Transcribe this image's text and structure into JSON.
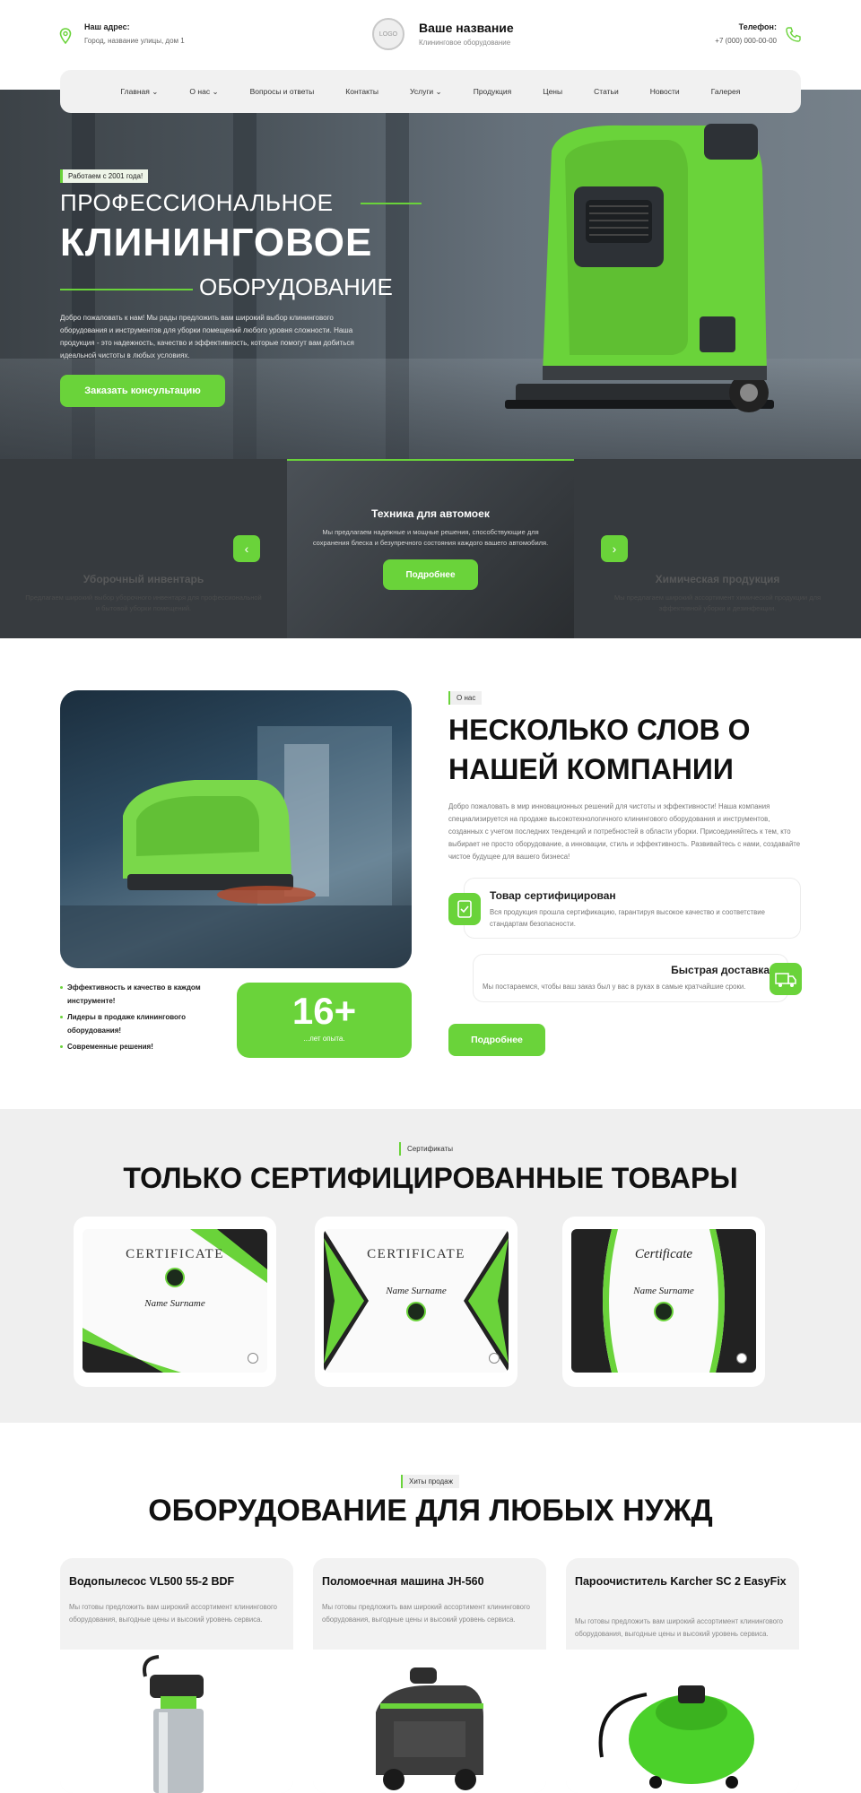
{
  "header": {
    "address_title": "Наш адрес:",
    "address_value": "Город, название улицы, дом 1",
    "logo_text": "LOGO",
    "brand_name": "Ваше название",
    "brand_subtitle": "Клининговое оборудование",
    "phone_title": "Телефон:",
    "phone_value": "+7 (000) 000-00-00"
  },
  "nav": {
    "items": [
      {
        "label": "Главная",
        "dropdown": true
      },
      {
        "label": "О нас",
        "dropdown": true
      },
      {
        "label": "Вопросы и ответы",
        "dropdown": false
      },
      {
        "label": "Контакты",
        "dropdown": false
      },
      {
        "label": "Услуги",
        "dropdown": true
      },
      {
        "label": "Продукция",
        "dropdown": false
      },
      {
        "label": "Цены",
        "dropdown": false
      },
      {
        "label": "Статьи",
        "dropdown": false
      },
      {
        "label": "Новости",
        "dropdown": false
      },
      {
        "label": "Галерея",
        "dropdown": false
      }
    ]
  },
  "hero": {
    "badge": "Работаем с 2001 года!",
    "title_line1": "ПРОФЕССИОНАЛЬНОЕ",
    "title_line2": "КЛИНИНГОВОЕ",
    "title_line3": "ОБОРУДОВАНИЕ",
    "description": "Добро пожаловать к нам! Мы рады предложить вам широкий выбор клинингового оборудования и инструментов для уборки помещений любого уровня сложности. Наша продукция - это надежность, качество и эффективность, которые помогут вам добиться идеальной чистоты в любых условиях.",
    "cta": "Заказать консультацию"
  },
  "slider": {
    "slides": [
      {
        "title": "Уборочный инвентарь",
        "text": "Предлагаем широкий выбор уборочного инвентаря для профессиональной и бытовой уборки помещений."
      },
      {
        "title": "Техника для автомоек",
        "text": "Мы предлагаем надежные и мощные решения, способствующие для сохранения блеска и безупречного состояния каждого вашего автомобиля.",
        "button": "Подробнее"
      },
      {
        "title": "Химическая продукция",
        "text": "Мы предлагаем широкий ассортимент химической продукции для эффективной уборки и дезинфекции."
      }
    ],
    "prev_icon": "chevron-left-icon",
    "next_icon": "chevron-right-icon"
  },
  "about": {
    "tag": "О нас",
    "title": "НЕСКОЛЬКО СЛОВ О НАШЕЙ КОМПАНИИ",
    "text": "Добро пожаловать в мир инновационных решений для чистоты и эффективности! Наша компания специализируется на продаже высокотехнологичного клинингового оборудования и инструментов, созданных с учетом последних тенденций и потребностей в области уборки. Присоединяйтесь к тем, кто выбирает не просто оборудование, а инновации, стиль и эффективность. Развивайтесь с нами, создавайте чистое будущее для вашего бизнеса!",
    "bullets": [
      "Эффективность и качество в каждом инструменте!",
      "Лидеры в продаже клинингового оборудования!",
      "Современные решения!"
    ],
    "experience_number": "16+",
    "experience_label": "...лет опыта.",
    "features": [
      {
        "title": "Товар сертифицирован",
        "text": "Вся продукция прошла сертификацию, гарантируя высокое качество и соответствие стандартам безопасности.",
        "icon": "certificate-icon"
      },
      {
        "title": "Быстрая доставка",
        "text": "Мы постараемся, чтобы ваш заказ был у вас в руках в самые кратчайшие сроки.",
        "icon": "truck-icon"
      }
    ],
    "button": "Подробнее"
  },
  "certificates": {
    "tag": "Сертификаты",
    "title": "ТОЛЬКО СЕРТИФИЦИРОВАННЫЕ ТОВАРЫ",
    "items": [
      {
        "heading": "CERTIFICATE",
        "name": "Name Surname"
      },
      {
        "heading": "CERTIFICATE",
        "name": "Name Surname"
      },
      {
        "heading": "Certificate",
        "name": "Name Surname"
      }
    ]
  },
  "products": {
    "tag": "Хиты продаж",
    "title": "ОБОРУДОВАНИЕ ДЛЯ ЛЮБЫХ НУЖД",
    "items": [
      {
        "title": "Водопылесос VL500 55-2 BDF",
        "text": "Мы готовы предложить вам широкий ассортимент клинингового оборудования, выгодные цены и высокий уровень сервиса."
      },
      {
        "title": "Поломоечная машина JH-560",
        "text": "Мы готовы предложить вам широкий ассортимент клинингового оборудования, выгодные цены и высокий уровень сервиса."
      },
      {
        "title": "Пароочиститель Karcher SC 2 EasyFix",
        "text": "Мы готовы предложить вам широкий ассортимент клинингового оборудования, выгодные цены и высокий уровень сервиса."
      }
    ]
  },
  "colors": {
    "accent": "#6ad33a",
    "dark": "#1d1d1d",
    "light_bg": "#efefef"
  }
}
